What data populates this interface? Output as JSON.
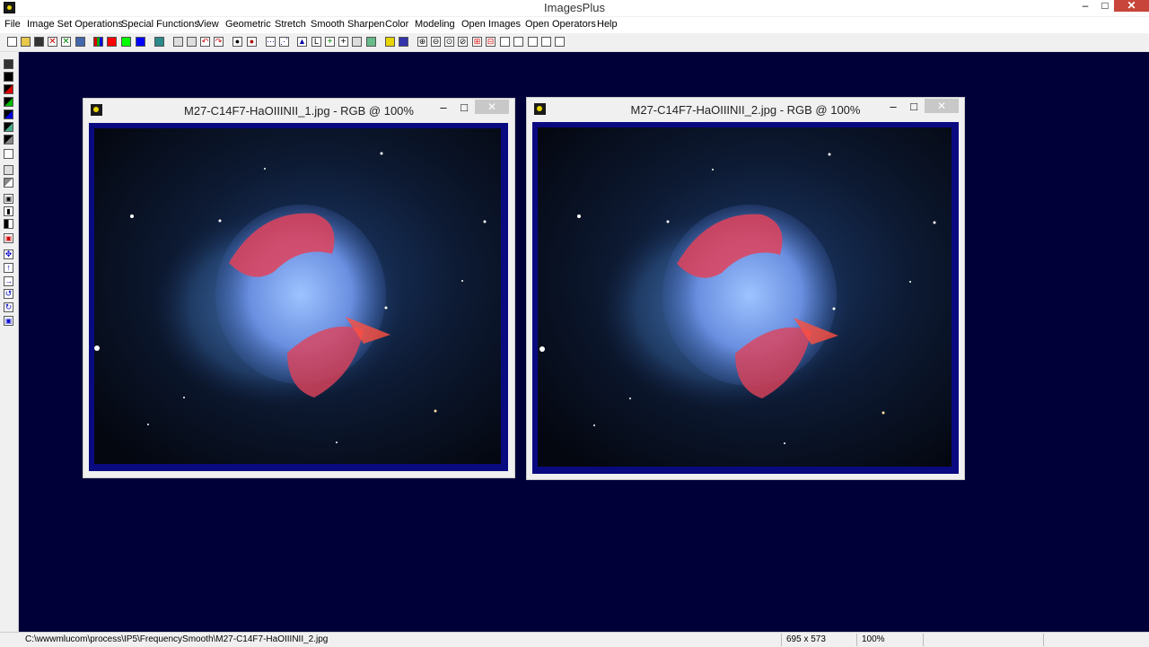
{
  "app": {
    "title": "ImagesPlus",
    "minimize_glyph": "–",
    "maximize_glyph": "□",
    "close_glyph": "✕"
  },
  "menu": [
    "File",
    "Image Set Operations",
    "Special Functions",
    "View",
    "Geometric",
    "Stretch",
    "Smooth Sharpen",
    "Color",
    "Modeling",
    "Open Images",
    "Open Operators",
    "Help"
  ],
  "windows": [
    {
      "title": "M27-C14F7-HaOIIINII_1.jpg - RGB @ 100%",
      "minimize_glyph": "–",
      "maximize_glyph": "□",
      "close_glyph": "✕"
    },
    {
      "title": "M27-C14F7-HaOIIINII_2.jpg - RGB @ 100%",
      "minimize_glyph": "–",
      "maximize_glyph": "□",
      "close_glyph": "✕"
    }
  ],
  "status": {
    "path": "C:\\wwwmlucom\\process\\IP5\\FrequencySmooth\\M27-C14F7-HaOIIINII_2.jpg",
    "dimensions": "695 x 573",
    "zoom": "100%"
  }
}
